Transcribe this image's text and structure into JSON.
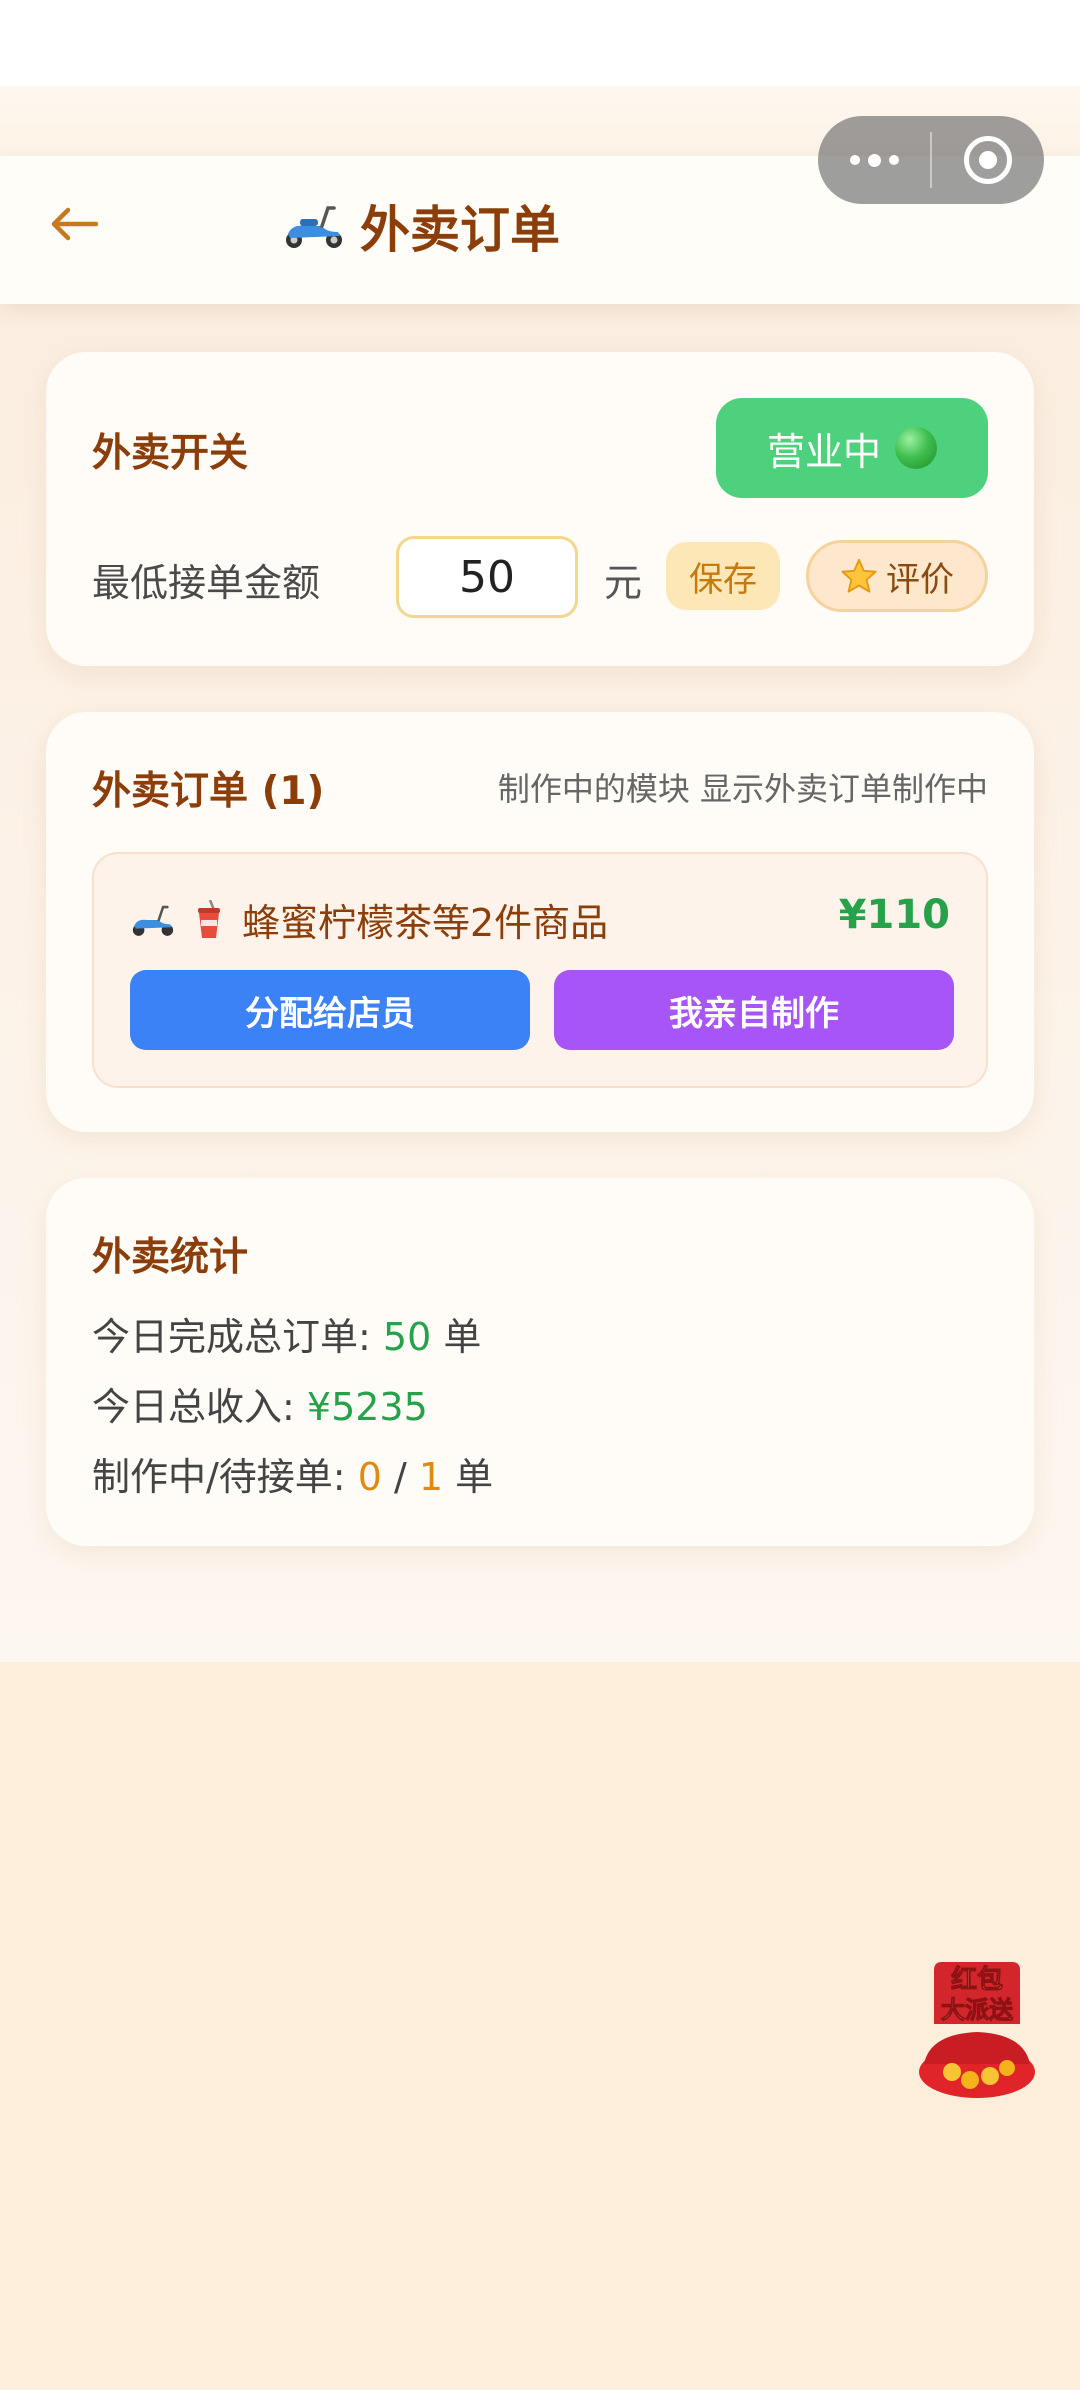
{
  "header": {
    "back_icon": "arrow-left-icon",
    "title_icon": "scooter-icon",
    "title": "外卖订单"
  },
  "capsule": {
    "more_icon": "more-dots-icon",
    "close_icon": "target-circle-icon"
  },
  "switch_card": {
    "title": "外卖开关",
    "toggle_label": "营业中",
    "toggle_color": "#4ed17c",
    "min_amount_label": "最低接单金额",
    "min_amount_value": "50",
    "unit": "元",
    "save_label": "保存",
    "review_label": "评价",
    "review_icon": "star-icon"
  },
  "orders_card": {
    "title": "外卖订单 (1)",
    "hint": "制作中的模块 显示外卖订单制作中",
    "orders": [
      {
        "name": "蜂蜜柠檬茶等2件商品",
        "price": "¥110",
        "icons": [
          "scooter-icon",
          "cup-icon"
        ],
        "assign_label": "分配给店员",
        "self_label": "我亲自制作"
      }
    ]
  },
  "stats_card": {
    "title": "外卖统计",
    "completed_label": "今日完成总订单: ",
    "completed_value": "50",
    "completed_unit": " 单",
    "income_label": "今日总收入: ",
    "income_value": "¥5235",
    "making_label": "制作中/待接单: ",
    "making_value": "0",
    "separator": " / ",
    "waiting_value": "1",
    "waiting_unit": " 单"
  },
  "floating": {
    "redpacket_text_1": "红包",
    "redpacket_text_2": "大派送"
  },
  "colors": {
    "accent_brown": "#8b3e0a",
    "blue_button": "#3b82f6",
    "purple_button": "#a855f7",
    "green_text": "#27a14a",
    "orange_text": "#e08a10"
  }
}
